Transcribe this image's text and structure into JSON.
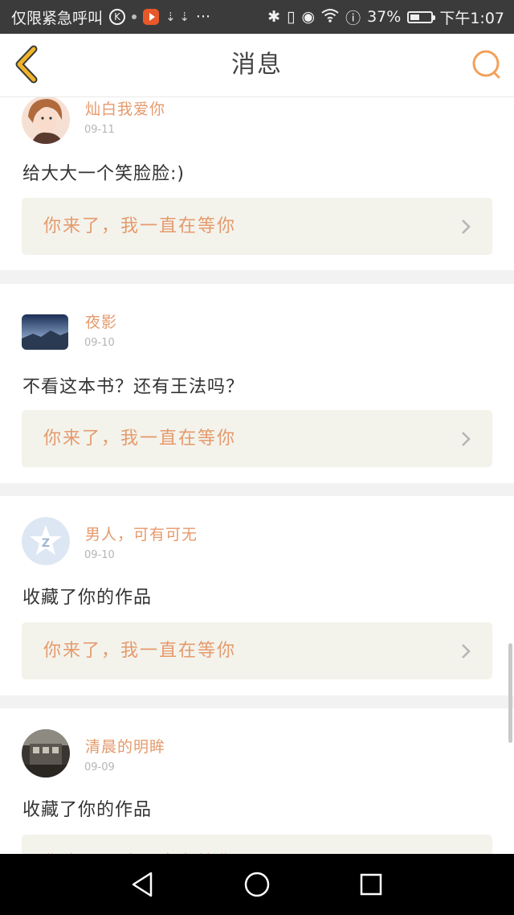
{
  "status_bar": {
    "carrier": "仅限紧急呼叫",
    "k_badge": "K",
    "overflow": "···",
    "battery": "37%",
    "time": "下午1:07"
  },
  "header": {
    "title": "消息"
  },
  "messages": [
    {
      "username": "灿白我爱你",
      "date": "09-11",
      "content": "给大大一个笑脸脸:)",
      "reply": "你来了，我一直在等你"
    },
    {
      "username": "夜影",
      "date": "09-10",
      "content": "不看这本书？还有王法吗？",
      "reply": "你来了，我一直在等你"
    },
    {
      "username": "男人，可有可无",
      "date": "09-10",
      "content": "收藏了你的作品",
      "reply": "你来了，我一直在等你"
    },
    {
      "username": "清晨的明眸",
      "date": "09-09",
      "content": "收藏了你的作品",
      "reply": "你来了，我一直在等你"
    }
  ],
  "colors": {
    "accent": "#e59a6c",
    "back_arrow": "#f0b429",
    "search_icon": "#f2a15a"
  }
}
